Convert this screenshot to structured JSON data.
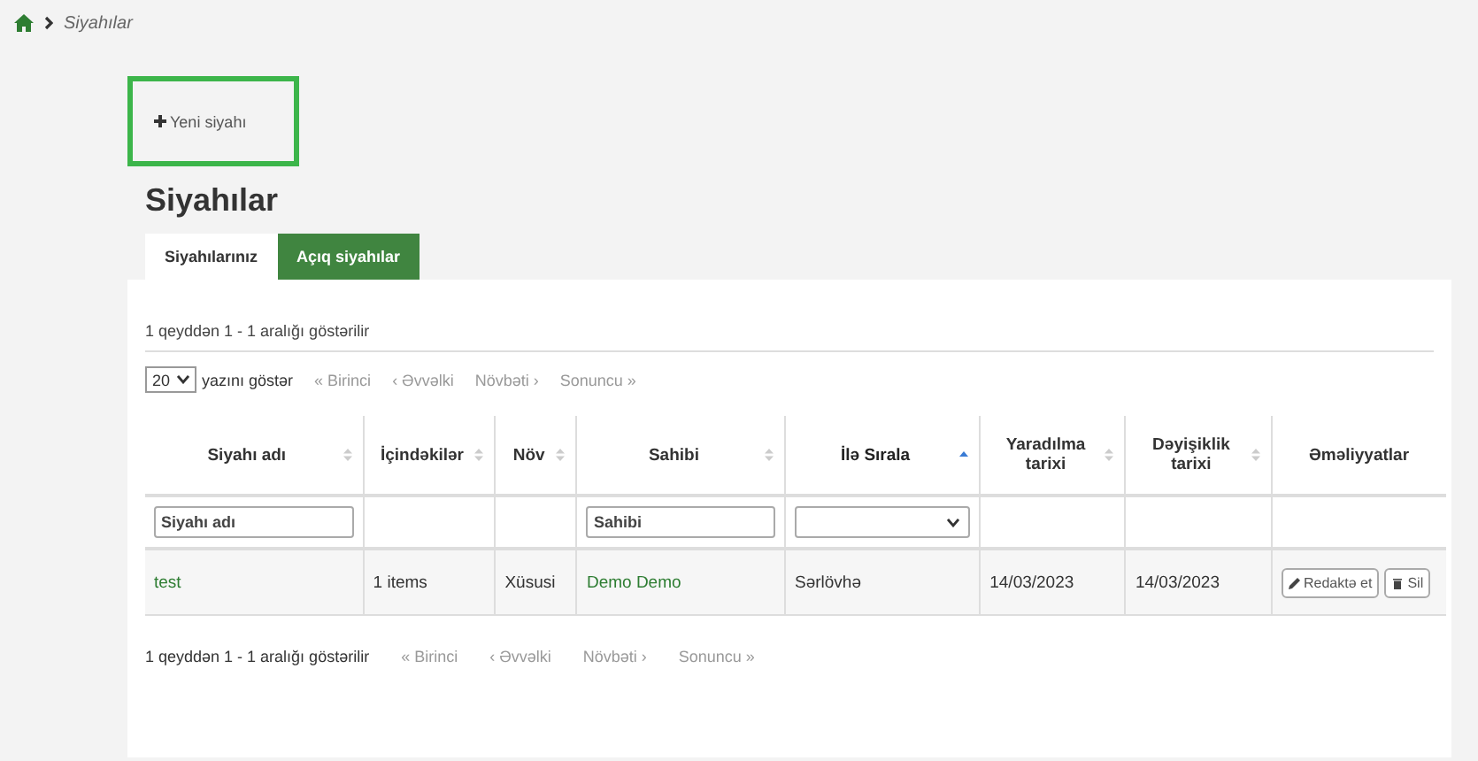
{
  "breadcrumb": {
    "items": [
      {
        "label": "Siyahılar",
        "selected": true
      }
    ]
  },
  "new_button": {
    "label": "Yeni siyahı"
  },
  "title": "Siyahılar",
  "tabs": [
    {
      "label": "Siyahılarınız",
      "selected": true
    },
    {
      "label": "Açıq siyahılar",
      "selected": false
    }
  ],
  "info_top": "1 qeyddən 1 - 1 aralığı göstərilir",
  "page_size": {
    "value": "20",
    "label": "yazını göstər"
  },
  "pager_top": [
    {
      "label": "« Birinci",
      "disabled": true
    },
    {
      "label": "‹ Əvvəlki",
      "disabled": true
    },
    {
      "label": "Növbəti ›",
      "disabled": true
    },
    {
      "label": "Sonuncu »",
      "disabled": true
    }
  ],
  "table": {
    "columns": [
      {
        "label": "Siyahı adı",
        "sortable": true,
        "sorted": false
      },
      {
        "label": "İçindəkilər",
        "sortable": true,
        "sorted": false
      },
      {
        "label": "Növ",
        "sortable": true,
        "sorted": false
      },
      {
        "label": "Sahibi",
        "sortable": true,
        "sorted": false
      },
      {
        "label": "İlə Sırala",
        "sortable": true,
        "sorted": true
      },
      {
        "label": "Yaradılma tarixi",
        "sortable": true,
        "sorted": false
      },
      {
        "label": "Dəyişiklik tarixi",
        "sortable": true,
        "sorted": false
      },
      {
        "label": "Əməliyyatlar",
        "sortable": false
      }
    ],
    "filters": [
      {
        "kind": "text",
        "placeholder": "Siyahı adı"
      },
      {
        "kind": "empty"
      },
      {
        "kind": "empty"
      },
      {
        "kind": "text",
        "placeholder": "Sahibi"
      },
      {
        "kind": "select"
      },
      {
        "kind": "empty"
      },
      {
        "kind": "empty"
      },
      {
        "kind": "empty"
      }
    ],
    "rows": [
      {
        "cells": [
          {
            "text": "test",
            "kind": "link"
          },
          {
            "text": "1 items",
            "kind": "text"
          },
          {
            "text": "Xüsusi",
            "kind": "text"
          },
          {
            "text": "Demo Demo",
            "kind": "link"
          },
          {
            "text": "Sərlövhə",
            "kind": "text"
          },
          {
            "text": "14/03/2023",
            "kind": "text"
          },
          {
            "text": "14/03/2023",
            "kind": "text"
          },
          {
            "kind": "actions",
            "buttons": [
              {
                "label": "Redaktə et",
                "kind": "edit"
              },
              {
                "label": "Sil",
                "kind": "delete"
              }
            ]
          }
        ]
      }
    ]
  },
  "info_bottom": "1 qeyddən 1 - 1 aralığı göstərilir",
  "pager_bottom": [
    {
      "label": "« Birinci",
      "disabled": true
    },
    {
      "label": "‹ Əvvəlki",
      "disabled": true
    },
    {
      "label": "Növbəti ›",
      "disabled": true
    },
    {
      "label": "Sonuncu »",
      "disabled": true
    }
  ]
}
